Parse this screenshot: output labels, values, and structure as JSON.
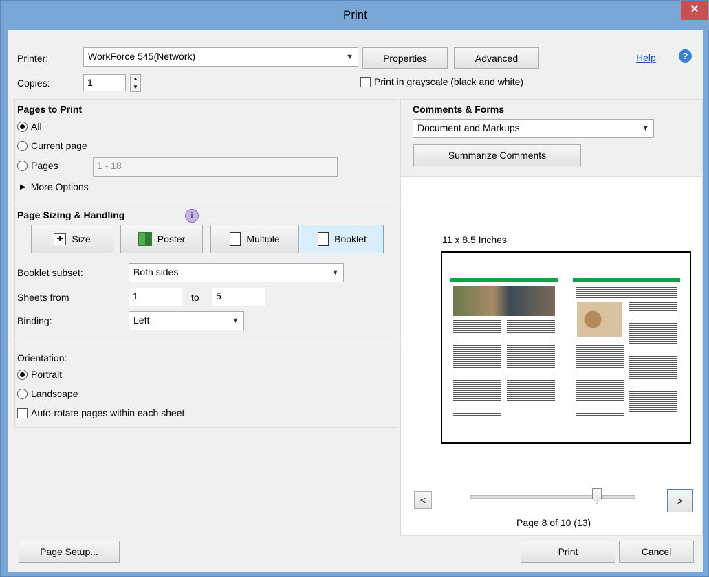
{
  "window": {
    "title": "Print",
    "close_glyph": "✕"
  },
  "header": {
    "printer_label": "Printer:",
    "printer_value": "WorkForce 545(Network)",
    "properties_button": "Properties",
    "advanced_button": "Advanced",
    "help_link": "Help",
    "copies_label": "Copies:",
    "copies_value": "1",
    "grayscale_label": "Print in grayscale (black and white)",
    "grayscale_checked": false
  },
  "pages_to_print": {
    "title": "Pages to Print",
    "all": "All",
    "current_page": "Current page",
    "pages": "Pages",
    "pages_value": "1 - 18",
    "more_options": "More Options",
    "selected": "All"
  },
  "page_sizing": {
    "title": "Page Sizing & Handling",
    "modes": [
      "Size",
      "Poster",
      "Multiple",
      "Booklet"
    ],
    "active_mode": "Booklet",
    "booklet_subset_label": "Booklet subset:",
    "booklet_subset_value": "Both sides",
    "sheets_from_label": "Sheets from",
    "sheets_from_value": "1",
    "to_label": "to",
    "sheets_to_value": "5",
    "binding_label": "Binding:",
    "binding_value": "Left"
  },
  "orientation": {
    "title": "Orientation:",
    "portrait": "Portrait",
    "landscape": "Landscape",
    "selected": "Portrait",
    "auto_rotate_label": "Auto-rotate pages within each sheet",
    "auto_rotate_checked": false
  },
  "comments_forms": {
    "title": "Comments & Forms",
    "value": "Document and Markups",
    "summarize_button": "Summarize Comments"
  },
  "preview": {
    "paper_size": "11 x 8.5 Inches",
    "prev_button": "<",
    "next_button": ">",
    "page_status": "Page 8 of 10 (13)",
    "position_fraction": 0.7
  },
  "footer": {
    "page_setup_button": "Page Setup...",
    "print_button": "Print",
    "cancel_button": "Cancel"
  }
}
